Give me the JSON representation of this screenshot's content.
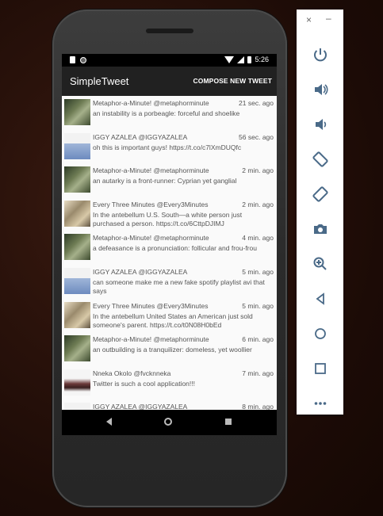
{
  "status": {
    "time": "5:26"
  },
  "app": {
    "title": "SimpleTweet",
    "compose_label": "COMPOSE NEW TWEET"
  },
  "tweets": [
    {
      "name": "Metaphor-a-Minute! @metaphorminute",
      "time": "21 sec. ago",
      "text": "an instability is a porbeagle: forceful and shoelike",
      "avatar": "meta"
    },
    {
      "name": "IGGY AZALEA  @IGGYAZALEA",
      "time": "56 sec. ago",
      "text": "oh this is important guys! https://t.co/c7lXmDUQfc",
      "avatar": "iggy"
    },
    {
      "name": "Metaphor-a-Minute! @metaphorminute",
      "time": "2 min. ago",
      "text": "an autarky is a front-runner: Cyprian yet ganglial",
      "avatar": "meta"
    },
    {
      "name": "Every Three Minutes @Every3Minutes",
      "time": "2 min. ago",
      "text": "In the antebellum U.S. South—a white person just purchased a person. https://t.co/6CttpDJIMJ",
      "avatar": "e3m"
    },
    {
      "name": "Metaphor-a-Minute! @metaphorminute",
      "time": "4 min. ago",
      "text": "a defeasance is a pronunciation: follicular and frou-frou",
      "avatar": "meta"
    },
    {
      "name": "IGGY AZALEA  @IGGYAZALEA",
      "time": "5 min. ago",
      "text": "can someone make me a new fake spotify playlist avi that says",
      "avatar": "iggy"
    },
    {
      "name": "Every Three Minutes @Every3Minutes",
      "time": "5 min. ago",
      "text": "In the antebellum United States an American just sold someone's parent. https://t.co/t0N08H0bEd",
      "avatar": "e3m"
    },
    {
      "name": "Metaphor-a-Minute! @metaphorminute",
      "time": "6 min. ago",
      "text": "an outbuilding is a tranquilizer: domeless, yet woollier",
      "avatar": "meta"
    },
    {
      "name": "Nneka Okolo @fvcknneka",
      "time": "7 min. ago",
      "text": "Twitter is such a cool application!!!",
      "avatar": "nneka"
    },
    {
      "name": "IGGY AZALEA  @IGGYAZALEA",
      "time": "8 min. ago",
      "text": "",
      "avatar": "iggy"
    }
  ],
  "emulator_controls": {
    "close": "×",
    "minimize": "–",
    "buttons": [
      "power-icon",
      "volume-up-icon",
      "volume-down-icon",
      "rotate-left-icon",
      "rotate-right-icon",
      "camera-icon",
      "zoom-icon",
      "back-icon",
      "home-icon",
      "overview-icon",
      "more-icon"
    ]
  }
}
